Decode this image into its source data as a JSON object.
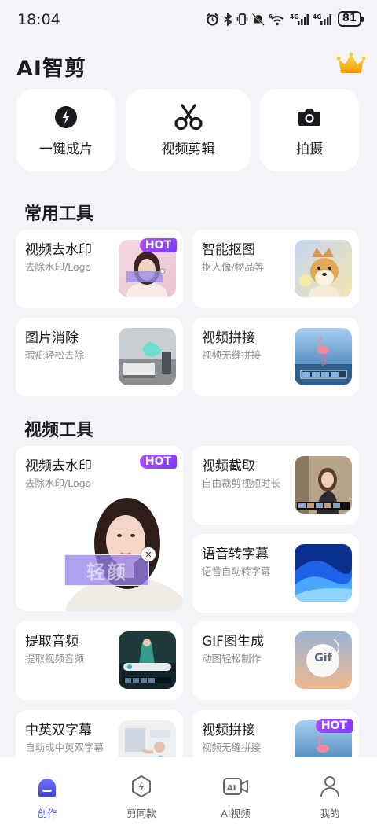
{
  "status_bar": {
    "time": "18:04",
    "battery": "81",
    "icons": [
      "alarm-icon",
      "bluetooth-icon",
      "vibrate-icon",
      "mute-icon",
      "wifi-icon",
      "4g-signal-icon",
      "4g-signal-icon"
    ]
  },
  "header": {
    "title": "AI智剪",
    "vip_icon": "crown-icon"
  },
  "quick_actions": [
    {
      "label": "一键成片",
      "icon": "lightning-icon"
    },
    {
      "label": "视频剪辑",
      "icon": "scissors-icon"
    },
    {
      "label": "拍摄",
      "icon": "camera-icon"
    }
  ],
  "common_tools": {
    "title": "常用工具",
    "items": [
      {
        "title": "视频去水印",
        "subtitle": "去除水印/Logo",
        "badge": "HOT"
      },
      {
        "title": "智能抠图",
        "subtitle": "抠人像/物品等"
      },
      {
        "title": "图片消除",
        "subtitle": "瑕疵轻松去除"
      },
      {
        "title": "视频拼接",
        "subtitle": "视频无缝拼接"
      }
    ]
  },
  "video_tools": {
    "title": "视频工具",
    "featured": {
      "title": "视频去水印",
      "subtitle": "去除水印/Logo",
      "badge": "HOT",
      "watermark_text": "轻颜"
    },
    "items": [
      {
        "title": "视频截取",
        "subtitle": "自由裁剪视频时长"
      },
      {
        "title": "语音转字幕",
        "subtitle": "语音自动转字幕"
      },
      {
        "title": "提取音频",
        "subtitle": "提取视频音频"
      },
      {
        "title": "GIF图生成",
        "subtitle": "动图轻松制作",
        "thumb_text": "Gif"
      },
      {
        "title": "中英双字幕",
        "subtitle": "自动成中英双字幕"
      },
      {
        "title": "视频拼接",
        "subtitle": "视频无缝拼接",
        "badge": "HOT"
      }
    ]
  },
  "tab_bar": {
    "active": "创作",
    "tabs": [
      {
        "label": "创作",
        "icon": "create-icon"
      },
      {
        "label": "剪同款",
        "icon": "template-icon"
      },
      {
        "label": "AI视频",
        "icon": "ai-video-icon"
      },
      {
        "label": "我的",
        "icon": "profile-icon"
      }
    ]
  },
  "colors": {
    "accent": "#4f52f0",
    "hot_badge": "#8a3fff",
    "background": "#f3f4f8"
  }
}
